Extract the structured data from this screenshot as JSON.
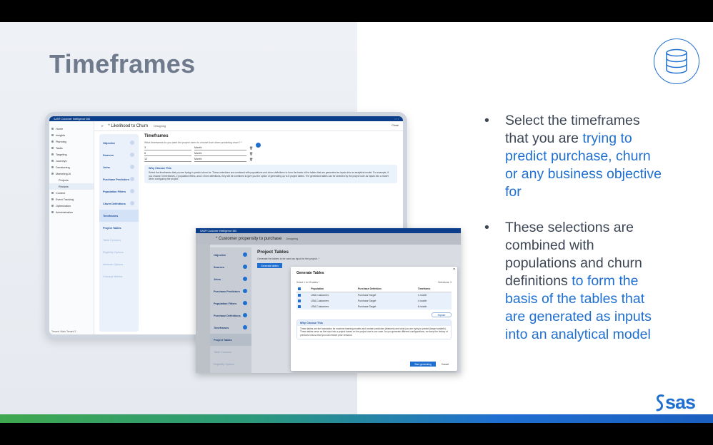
{
  "slide": {
    "title": "Timeframes",
    "bullets": [
      {
        "parts": [
          {
            "text": "Select the timeframes that you are ",
            "hl": false
          },
          {
            "text": "trying to predict purchase, churn or any business objective for",
            "hl": true
          }
        ]
      },
      {
        "parts": [
          {
            "text": "These selections are combined with populations and churn definitions ",
            "hl": false
          },
          {
            "text": "to form the basis of the tables that are generated as inputs into an analytical model",
            "hl": true
          }
        ]
      }
    ],
    "logo": "sas",
    "colors": {
      "accent": "#1f6fd1",
      "title": "#6f7a8c"
    }
  },
  "screen1": {
    "app": "SAS® Customer Intelligence 360",
    "project": "* Likelihood to Churn",
    "status": "Designing",
    "close": "Close",
    "nav": [
      {
        "label": "Home",
        "sub": false,
        "active": false
      },
      {
        "label": "Insights",
        "sub": false,
        "active": false
      },
      {
        "label": "Planning",
        "sub": false,
        "active": false
      },
      {
        "label": "Tasks",
        "sub": false,
        "active": false
      },
      {
        "label": "Targeting",
        "sub": false,
        "active": false
      },
      {
        "label": "Journeys",
        "sub": false,
        "active": false
      },
      {
        "label": "Decisioning",
        "sub": false,
        "active": false
      },
      {
        "label": "Marketing AI",
        "sub": false,
        "active": false
      },
      {
        "label": "Projects",
        "sub": true,
        "active": false
      },
      {
        "label": "Recipes",
        "sub": true,
        "active": true
      },
      {
        "label": "Content",
        "sub": false,
        "active": false
      },
      {
        "label": "Event Tracking",
        "sub": false,
        "active": false
      },
      {
        "label": "Optimization",
        "sub": false,
        "active": false
      },
      {
        "label": "Administration",
        "sub": false,
        "active": false
      }
    ],
    "tenant": "Tenant: Main Tenant 2",
    "steps": [
      {
        "label": "Objective",
        "state": "done"
      },
      {
        "label": "Sources",
        "state": "done"
      },
      {
        "label": "Joins",
        "state": "done"
      },
      {
        "label": "Purchase Predictors",
        "state": "done"
      },
      {
        "label": "Population Filters",
        "state": "done"
      },
      {
        "label": "Churn Definitions",
        "state": "done"
      },
      {
        "label": "Timeframes",
        "state": "active"
      },
      {
        "label": "Project Tables",
        "state": "normal"
      },
      {
        "label": "Table Columns",
        "state": "dim"
      },
      {
        "label": "Eligibility Options",
        "state": "dim"
      },
      {
        "label": "Attribute Options",
        "state": "dim"
      },
      {
        "label": "Concept Metrics",
        "state": "dim"
      }
    ],
    "heading": "Timeframes",
    "question": "What timeframes do you want the project users to choose from when predicting churn? *",
    "rows": [
      {
        "num": "3",
        "unit": "Month"
      },
      {
        "num": "6",
        "unit": "Month"
      },
      {
        "num": "12",
        "unit": "Month"
      }
    ],
    "why_title": "Why Choose This",
    "why_body": "Select the timeframes that you are trying to predict churn for. These selections are combined with populations and churn definitions to form the basis of the tables that are generated as inputs into an analytical model. For example, if you choose 3 timeframes, 2 population filters, and 2 churn definitions, they will be combined to give you the option of generating up to 8 project tables. The generated tables can be selected by the project user as inputs into a model when configuring the project."
  },
  "screen2": {
    "app": "SAS® Customer Intelligence 360",
    "project": "* Customer propensity to purchase",
    "status": "Designing",
    "steps": [
      {
        "label": "Objective",
        "state": "done"
      },
      {
        "label": "Sources",
        "state": "done"
      },
      {
        "label": "Joins",
        "state": "done"
      },
      {
        "label": "Purchase Predictors",
        "state": "done"
      },
      {
        "label": "Population Filters",
        "state": "done"
      },
      {
        "label": "Purchase Definitions",
        "state": "done"
      },
      {
        "label": "Timeframes",
        "state": "done"
      },
      {
        "label": "Project Tables",
        "state": "active"
      },
      {
        "label": "Table Columns",
        "state": "dim"
      },
      {
        "label": "Eligibility Options",
        "state": "dim"
      }
    ],
    "heading": "Project Tables",
    "question": "Generate the tables to be used as input for the project. *",
    "generate_label": "Generate tables",
    "modal": {
      "title": "Generate Tables",
      "select_hint": "Select 1 to 12 tables *",
      "selections": "Selections: 3",
      "columns": [
        "Population",
        "Purchase Definition",
        "Timeframe"
      ],
      "rows": [
        [
          "USA Customers",
          "Purchase Target",
          "1 month"
        ],
        [
          "USA Customers",
          "Purchase Target",
          "4 month"
        ],
        [
          "USA Customers",
          "Purchase Target",
          "6 month"
        ]
      ],
      "explain": "Explain",
      "why_title": "Why Choose This",
      "why_body": "These tables are the foundation for machine learning models and contain predictors (features) and what you are trying to predict (target variable). These tables serve as the input into a project based on the project user's use case. As you generate different configurations, we keep the history of previous runs so that you can restore prior versions.",
      "primary": "Start generating",
      "cancel": "Cancel"
    }
  }
}
